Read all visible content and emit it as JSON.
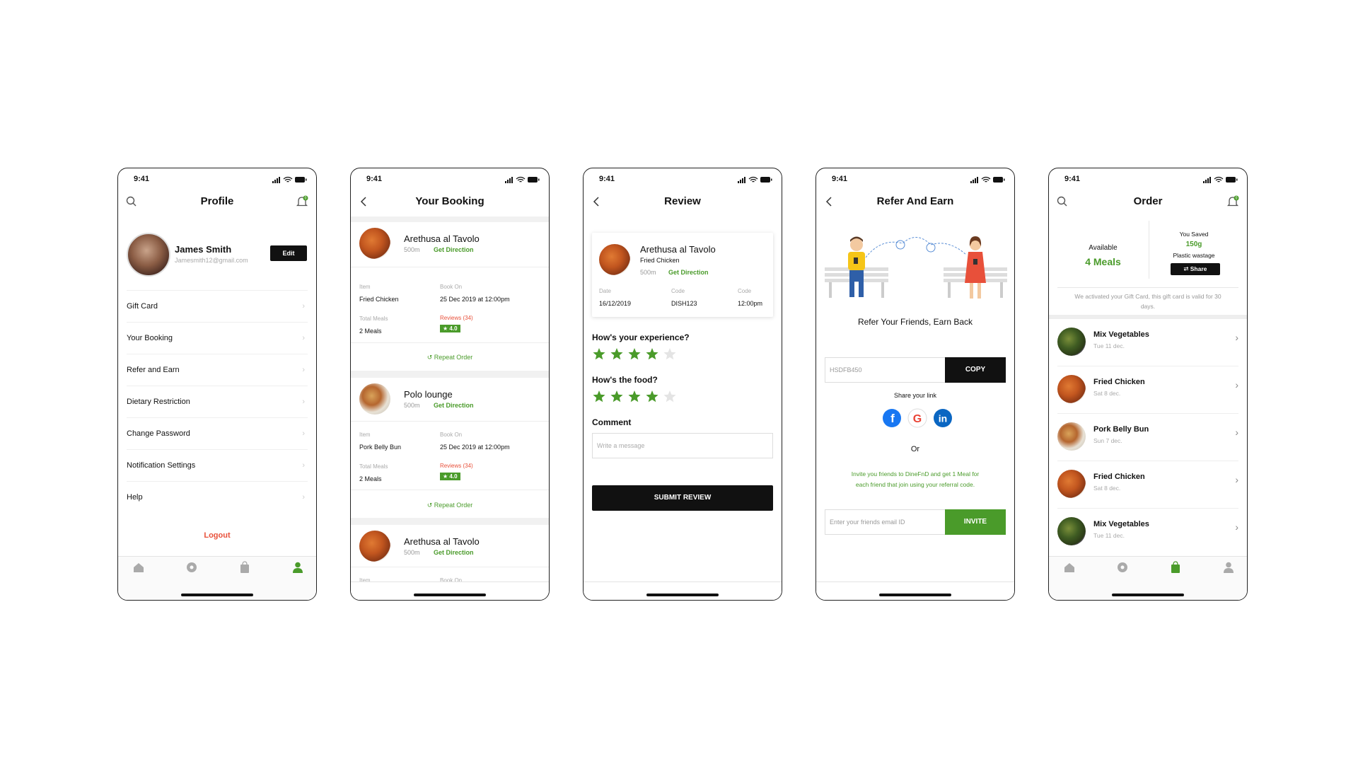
{
  "status_time": "9:41",
  "colors": {
    "accent": "#4a9b2a",
    "danger": "#e8503a",
    "dark": "#111111"
  },
  "profile": {
    "title": "Profile",
    "badge": "0",
    "name": "James Smith",
    "email": "Jamesmith12@gmail.com",
    "edit_label": "Edit",
    "menu": [
      "Gift Card",
      "Your Booking",
      "Refer and Earn",
      "Dietary Restriction",
      "Change Password",
      "Notification Settings",
      "Help"
    ],
    "logout": "Logout"
  },
  "booking": {
    "title": "Your Booking",
    "cards": [
      {
        "restaurant": "Arethusa al Tavolo",
        "distance": "500m",
        "direction": "Get Direction",
        "item_label": "Item",
        "item": "Fried Chicken",
        "book_label": "Book On",
        "book_on": "25 Dec 2019 at 12:00pm",
        "meals_label": "Total Meals",
        "meals": "2 Meals",
        "reviews": "Reviews (34)",
        "rating": "★ 4.0",
        "repeat": "Repeat Order"
      },
      {
        "restaurant": "Polo lounge",
        "distance": "500m",
        "direction": "Get Direction",
        "item_label": "Item",
        "item": "Pork Belly Bun",
        "book_label": "Book On",
        "book_on": "25 Dec 2019 at 12:00pm",
        "meals_label": "Total Meals",
        "meals": "2 Meals",
        "reviews": "Reviews (34)",
        "rating": "★ 4.0",
        "repeat": "Repeat Order"
      },
      {
        "restaurant": "Arethusa al Tavolo",
        "distance": "500m",
        "direction": "Get Direction",
        "item_label": "Item",
        "book_label": "Book On"
      }
    ]
  },
  "review": {
    "title": "Review",
    "restaurant": "Arethusa al Tavolo",
    "item": "Fried Chicken",
    "distance": "500m",
    "direction": "Get Direction",
    "date_label": "Date",
    "date": "16/12/2019",
    "code_label": "Code",
    "code": "DISH123",
    "time_label": "Code",
    "time": "12:00pm",
    "q1": "How's your experience?",
    "q1_rating": 4,
    "q2": "How's the food?",
    "q2_rating": 4,
    "comment_label": "Comment",
    "comment_placeholder": "Write a message",
    "submit": "SUBMIT REVIEW"
  },
  "refer": {
    "title": "Refer And Earn",
    "headline": "Refer Your Friends, Earn Back",
    "code": "HSDFB450",
    "copy": "COPY",
    "share_label": "Share your link",
    "social_icons": [
      "facebook-icon",
      "google-icon",
      "linkedin-icon"
    ],
    "or": "Or",
    "invite_text": "Invite you friends to DineFnD and get 1 Meal for each friend that join using your referral code.",
    "email_placeholder": "Enter your friends email ID",
    "invite": "INVITE"
  },
  "order": {
    "title": "Order",
    "badge": "0",
    "available_label": "Available",
    "available_value": "4 Meals",
    "saved_label": "You Saved",
    "saved_value": "150g",
    "saved_sub": "Plastic wastage",
    "share": "Share",
    "gift_note": "We activated your Gift Card, this gift card is valid for 30 days.",
    "items": [
      {
        "name": "Mix Vegetables",
        "date": "Tue 11 dec.",
        "img": "veg"
      },
      {
        "name": "Fried Chicken",
        "date": "Sat 8 dec.",
        "img": "chicken"
      },
      {
        "name": "Pork Belly Bun",
        "date": "Sun 7 dec.",
        "img": "pork"
      },
      {
        "name": "Fried Chicken",
        "date": "Sat 8 dec.",
        "img": "chicken"
      },
      {
        "name": "Mix Vegetables",
        "date": "Tue 11 dec.",
        "img": "veg"
      }
    ]
  }
}
